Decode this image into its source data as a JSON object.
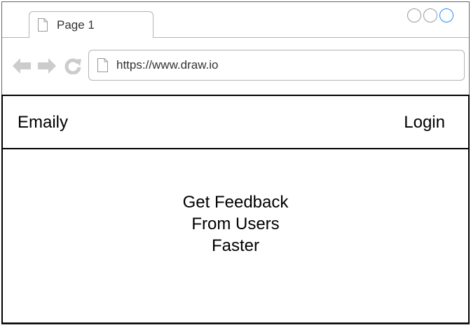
{
  "browser": {
    "tab": {
      "label": "Page 1",
      "icon": "page-icon"
    },
    "window_controls": [
      "minimize",
      "maximize",
      "close"
    ],
    "nav": {
      "back_icon": "back-arrow-icon",
      "forward_icon": "forward-arrow-icon",
      "reload_icon": "reload-icon"
    },
    "address_bar": {
      "url": "https://www.draw.io",
      "icon": "page-icon"
    },
    "colors": {
      "chrome_border": "#b3b3b3",
      "nav_icon": "#cccccc",
      "active_control": "#1e90ff"
    }
  },
  "header": {
    "brand": "Emaily",
    "login_label": "Login"
  },
  "hero": {
    "lines": [
      "Get Feedback",
      "From Users",
      "Faster"
    ]
  }
}
